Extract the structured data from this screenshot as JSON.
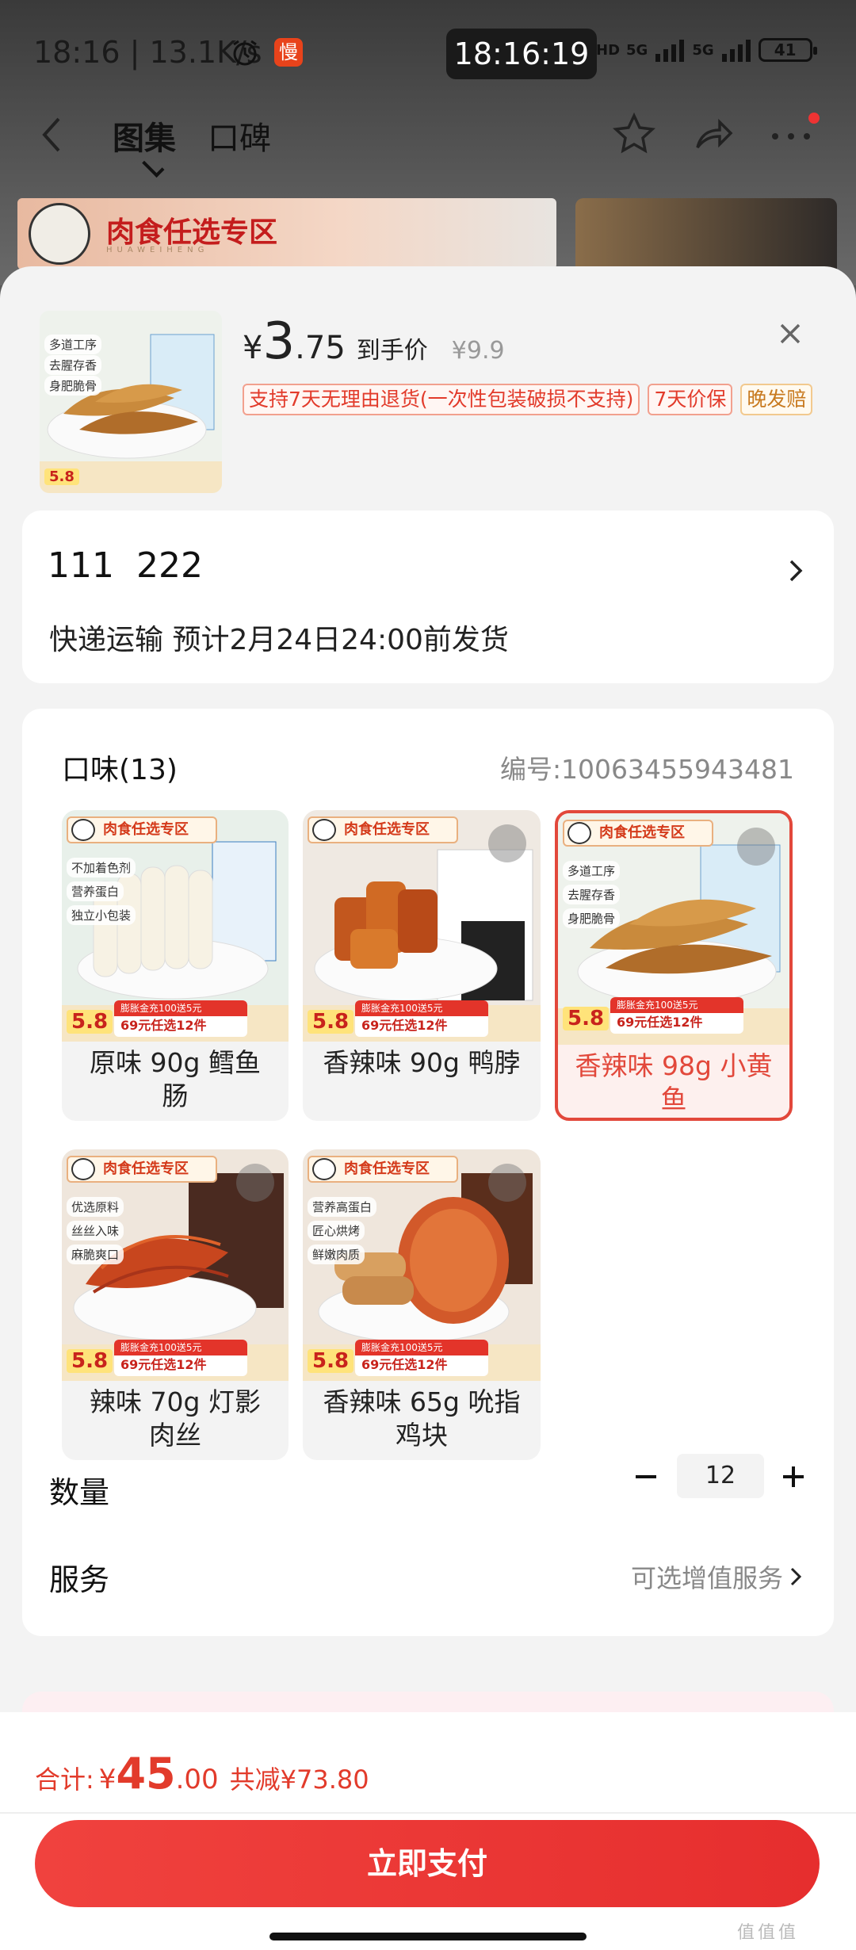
{
  "status_bar": {
    "time_speed": "18:16 | 13.1K/s",
    "clock": "18:16:19",
    "signal_1": "5G",
    "signal_2": "5G",
    "hd_label": "HD",
    "battery": "41",
    "app_icon_char": "慢"
  },
  "nav": {
    "tabs": [
      "图集",
      "口碑"
    ],
    "icons": [
      "back-arrow-icon",
      "star-icon",
      "share-icon",
      "more-icon"
    ]
  },
  "background_banner": {
    "title": "肉食任选专区",
    "sub": "HUAWEIHENG"
  },
  "product": {
    "currency": "¥",
    "price_int": "3",
    "price_dec": ".75",
    "price_tag": "到手价",
    "original_price": "¥9.9",
    "badges": [
      "支持7天无理由退货(一次性包装破损不支持)",
      "7天价保",
      "晚发赔"
    ]
  },
  "address": {
    "name": "111  222",
    "shipping": "快递运输 预计2月24日24:00前发货"
  },
  "options": {
    "flavor_title": "口味(13)",
    "sku_number": "编号:10063455943481",
    "tag_text": "肉食任选专区",
    "price_badge": "5.8",
    "promo_top": "膨胀金充100送5元",
    "promo_bottom": "69元任选12件",
    "variants": [
      {
        "label": "原味 90g 鳕鱼肠",
        "selected": false,
        "features": [
          "不加着色剂",
          "营养蛋白",
          "独立小包装"
        ]
      },
      {
        "label": "香辣味 90g 鸭脖",
        "selected": false,
        "features": []
      },
      {
        "label": "香辣味 98g 小黄鱼",
        "selected": true,
        "features": [
          "多道工序",
          "去腥存香",
          "身肥脆骨"
        ]
      },
      {
        "label": "辣味 70g 灯影肉丝",
        "selected": false,
        "features": [
          "优选原料",
          "丝丝入味",
          "麻脆爽口"
        ]
      },
      {
        "label": "香辣味 65g 吮指鸡块",
        "selected": false,
        "features": [
          "营养高蛋白",
          "匠心烘烤",
          "鲜嫩肉质"
        ]
      }
    ],
    "quantity_label": "数量",
    "quantity": "12",
    "service_label": "服务",
    "service_value": "可选增值服务"
  },
  "main_thumb_features": [
    "多道工序",
    "去腥存香",
    "身肥脆骨"
  ],
  "footer": {
    "total_label": "合计:",
    "currency": "¥",
    "total_int": "45",
    "total_dec": ".00",
    "saved": "共减¥73.80",
    "pay_label": "立即支付"
  },
  "watermark": "值值值",
  "colors": {
    "accent": "#e62e2e",
    "selected_border": "#e2483b"
  }
}
